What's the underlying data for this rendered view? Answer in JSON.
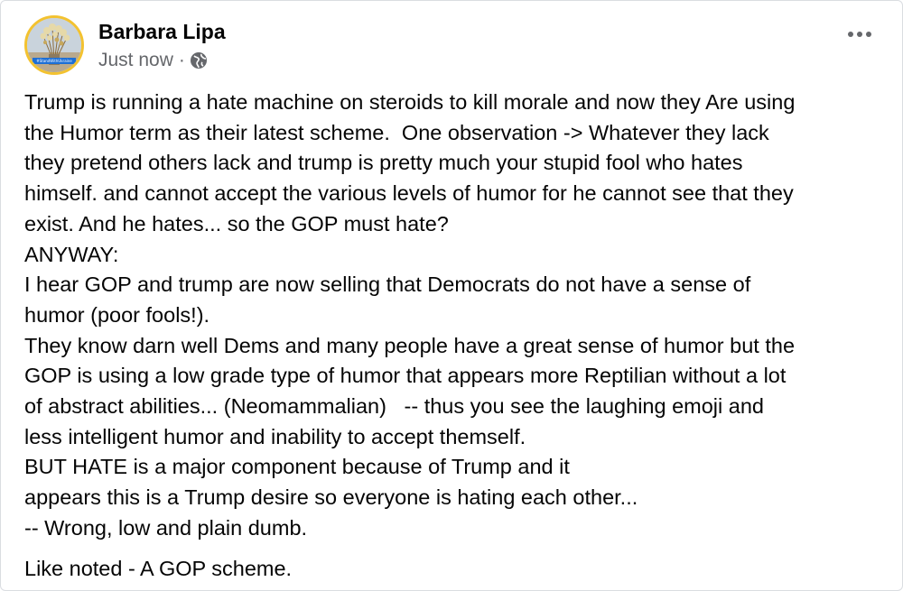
{
  "post": {
    "author": "Barbara Lipa",
    "timestamp": "Just now",
    "separator": "·",
    "audience_icon": "globe-icon",
    "avatar_badge": "#StandWithUkraine",
    "body_lines": [
      "Trump is running a hate machine on steroids to kill morale and now they Are using",
      "the Humor term as their latest scheme.  One observation -> Whatever they lack",
      "they pretend others lack and trump is pretty much your stupid fool who hates",
      "himself. and cannot accept the various levels of humor for he cannot see that they",
      "exist. And he hates... so the GOP must hate?",
      "ANYWAY:",
      "I hear GOP and trump are now selling that Democrats do not have a sense of",
      "humor (poor fools!).",
      "They know darn well Dems and many people have a great sense of humor but the",
      "GOP is using a low grade type of humor that appears more Reptilian without a lot",
      "of abstract abilities... (Neomammalian)   -- thus you see the laughing emoji and",
      "less intelligent humor and inability to accept themself.",
      "BUT HATE is a major component because of Trump and it",
      "appears this is a Trump desire so everyone is hating each other...",
      "-- Wrong, low and plain dumb."
    ],
    "closing": "Like noted - A GOP scheme."
  },
  "colors": {
    "text": "#050505",
    "secondary_text": "#65676b",
    "avatar_ring": "#f3c230",
    "badge": "#1d6fd6"
  }
}
